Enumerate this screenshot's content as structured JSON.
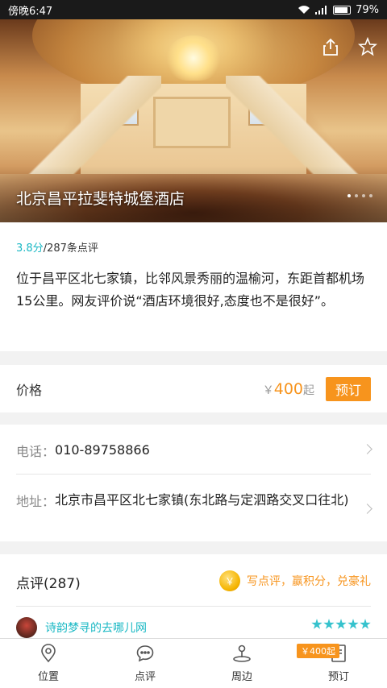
{
  "status_bar": {
    "time": "傍晚6:47",
    "battery": "79%"
  },
  "hotel": {
    "name": "北京昌平拉斐特城堡酒店",
    "rating_score": "3.8分",
    "rating_count": "/287条点评",
    "description": "位于昌平区北七家镇，比邻风景秀丽的温榆河，东距首都机场15公里。网友评价说“酒店环境很好,态度也不是很好”。"
  },
  "price": {
    "label": "价格",
    "currency": "￥",
    "amount": "400",
    "suffix": "起",
    "book_label": "预订"
  },
  "contact": {
    "phone_label": "电话：",
    "phone": "010-89758866",
    "address_label": "地址：",
    "address": "北京市昌平区北七家镇(东北路与定泗路交叉口往北)"
  },
  "reviews": {
    "title": "点评(287)",
    "cta": "写点评，赢积分，兑豪礼",
    "coin_symbol": "￥",
    "first_reviewer": "诗韵梦寻的去哪儿网",
    "first_rating": 5
  },
  "bottom_nav": {
    "items": [
      {
        "label": "位置",
        "icon": "location-icon"
      },
      {
        "label": "点评",
        "icon": "comment-icon"
      },
      {
        "label": "周边",
        "icon": "nearby-icon"
      },
      {
        "label": "预订",
        "icon": "booking-icon"
      }
    ],
    "badge": "￥400起"
  },
  "colors": {
    "accent_orange": "#f7941d",
    "accent_teal": "#19b8c4"
  }
}
